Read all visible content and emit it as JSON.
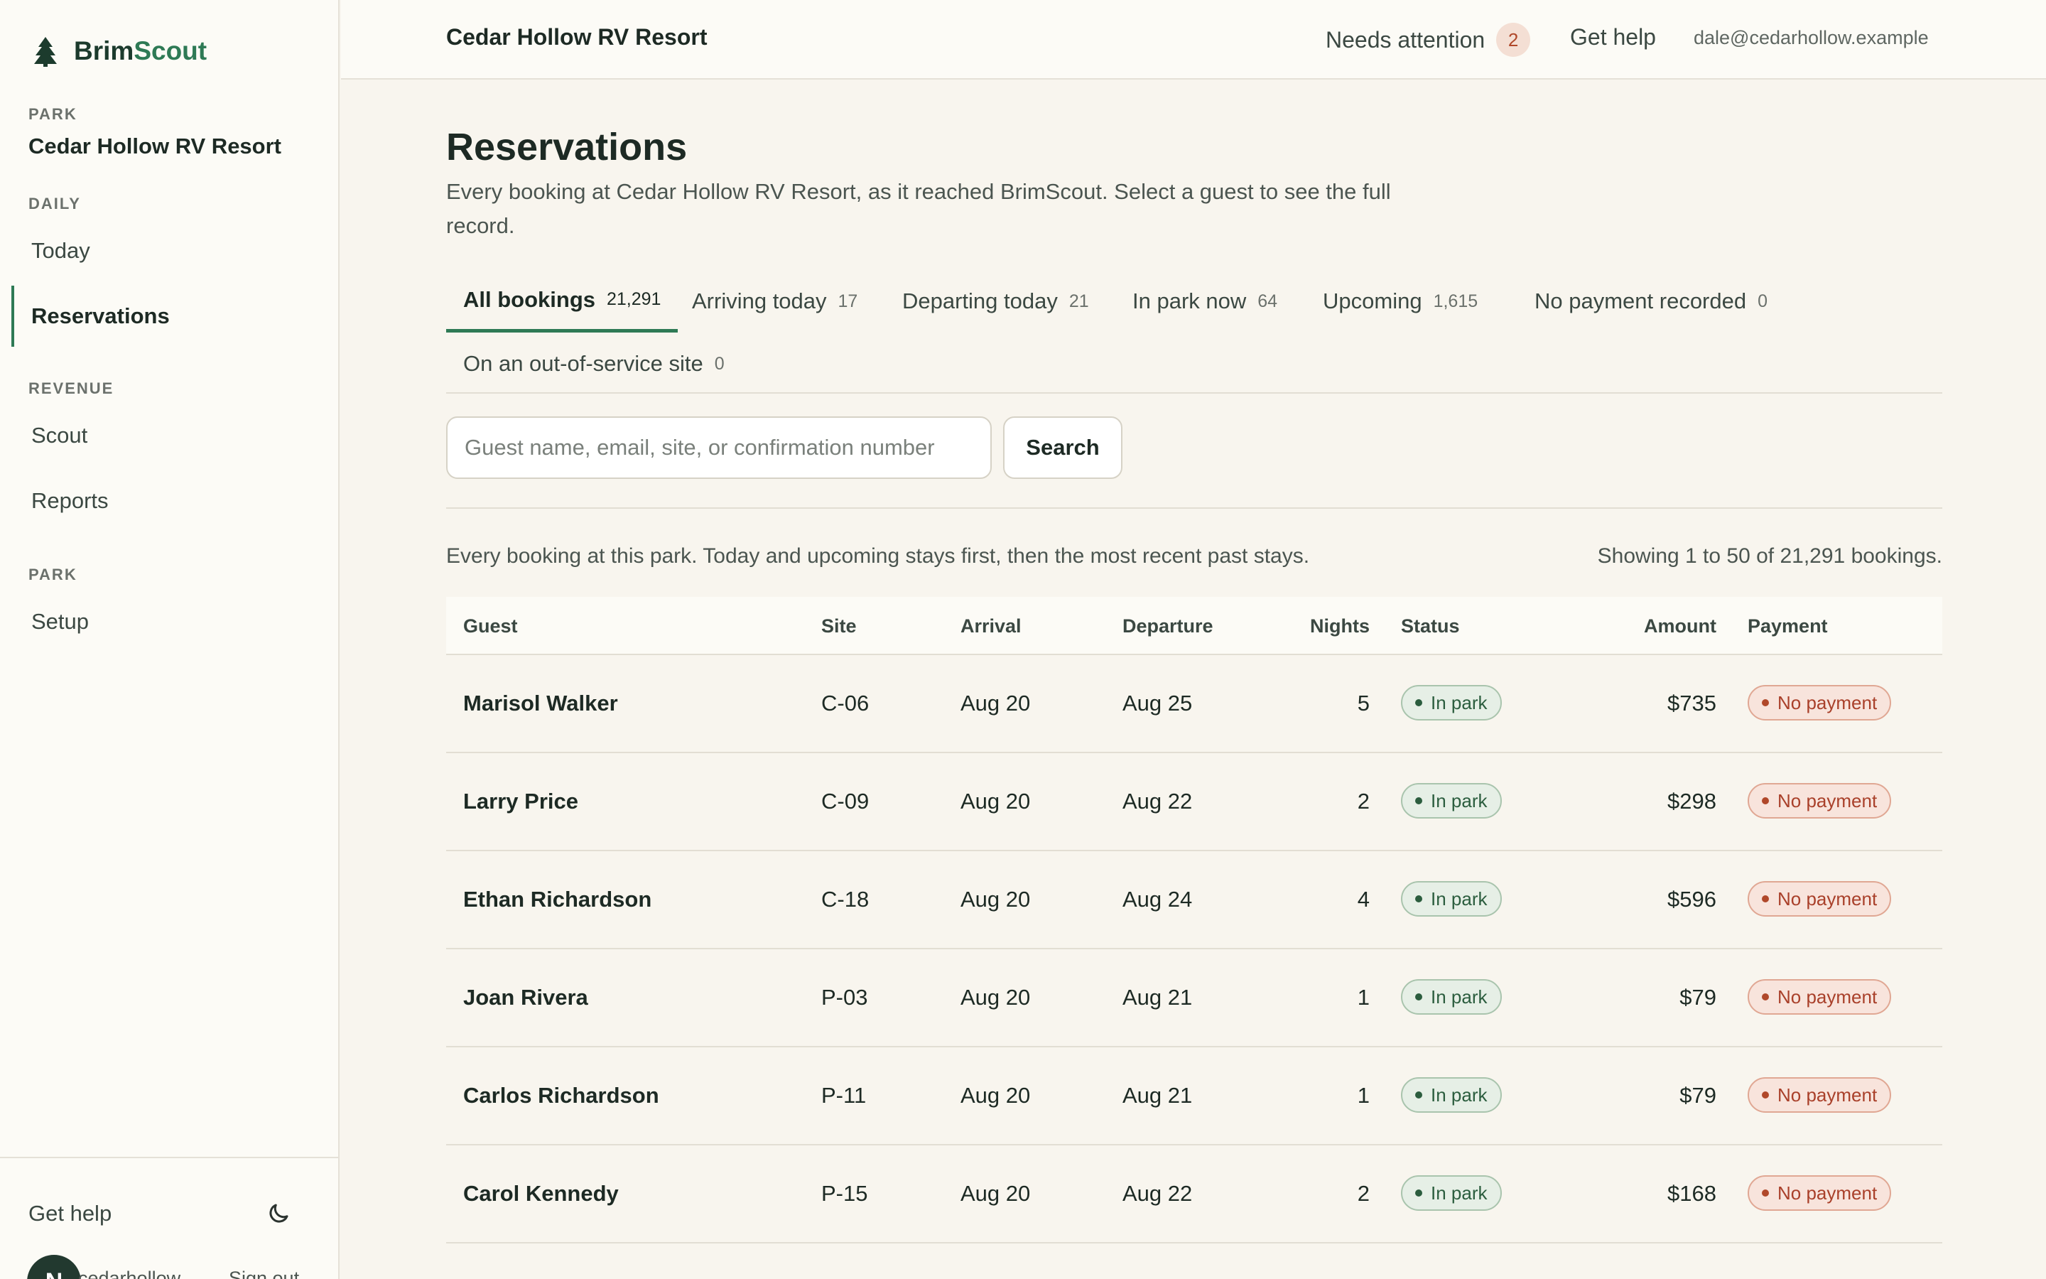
{
  "sidebar": {
    "brand_part1": "Brim",
    "brand_part2": "Scout",
    "park_section_label": "PARK",
    "park_name": "Cedar Hollow RV Resort",
    "daily_label": "DAILY",
    "revenue_label": "REVENUE",
    "park_label2": "PARK",
    "items": [
      {
        "label": "Today"
      },
      {
        "label": "Reservations"
      },
      {
        "label": "Scout"
      },
      {
        "label": "Reports"
      },
      {
        "label": "Setup"
      }
    ],
    "help": "Get help",
    "avatar_initial": "N",
    "account_name": "cedarhollow",
    "sign_out": "Sign out"
  },
  "topbar": {
    "park_title": "Cedar Hollow RV Resort",
    "needs_attention": "Needs attention",
    "needs_count": "2",
    "help": "Get help",
    "email": "dale@cedarhollow.example"
  },
  "page": {
    "title": "Reservations",
    "description": "Every booking at Cedar Hollow RV Resort, as it reached BrimScout. Select a guest to see the full record."
  },
  "tabs": [
    {
      "label": "All bookings",
      "count": "21,291"
    },
    {
      "label": "Arriving today",
      "count": "17"
    },
    {
      "label": "Departing today",
      "count": "21"
    },
    {
      "label": "In park now",
      "count": "64"
    },
    {
      "label": "Upcoming",
      "count": "1,615"
    },
    {
      "label": "No payment recorded",
      "count": "0"
    },
    {
      "label": "On an out-of-service site",
      "count": "0"
    }
  ],
  "search": {
    "placeholder": "Guest name, email, site, or confirmation number",
    "button": "Search"
  },
  "list": {
    "note": "Every booking at this park. Today and upcoming stays first, then the most recent past stays.",
    "showing": "Showing 1 to 50 of 21,291 bookings."
  },
  "table": {
    "headers": {
      "guest": "Guest",
      "site": "Site",
      "arrival": "Arrival",
      "departure": "Departure",
      "nights": "Nights",
      "status": "Status",
      "amount": "Amount",
      "payment": "Payment"
    },
    "rows": [
      {
        "guest": "Marisol Walker",
        "site": "C-06",
        "arrival": "Aug 20",
        "departure": "Aug 25",
        "nights": "5",
        "status": "In park",
        "amount": "$735",
        "payment": "No payment"
      },
      {
        "guest": "Larry Price",
        "site": "C-09",
        "arrival": "Aug 20",
        "departure": "Aug 22",
        "nights": "2",
        "status": "In park",
        "amount": "$298",
        "payment": "No payment"
      },
      {
        "guest": "Ethan Richardson",
        "site": "C-18",
        "arrival": "Aug 20",
        "departure": "Aug 24",
        "nights": "4",
        "status": "In park",
        "amount": "$596",
        "payment": "No payment"
      },
      {
        "guest": "Joan Rivera",
        "site": "P-03",
        "arrival": "Aug 20",
        "departure": "Aug 21",
        "nights": "1",
        "status": "In park",
        "amount": "$79",
        "payment": "No payment"
      },
      {
        "guest": "Carlos Richardson",
        "site": "P-11",
        "arrival": "Aug 20",
        "departure": "Aug 21",
        "nights": "1",
        "status": "In park",
        "amount": "$79",
        "payment": "No payment"
      },
      {
        "guest": "Carol Kennedy",
        "site": "P-15",
        "arrival": "Aug 20",
        "departure": "Aug 22",
        "nights": "2",
        "status": "In park",
        "amount": "$168",
        "payment": "No payment"
      }
    ]
  },
  "colors": {
    "brand_green": "#2e7a55",
    "status_green": "#2b5d3e",
    "payment_red": "#b0482a",
    "background": "#f8f5ee"
  }
}
